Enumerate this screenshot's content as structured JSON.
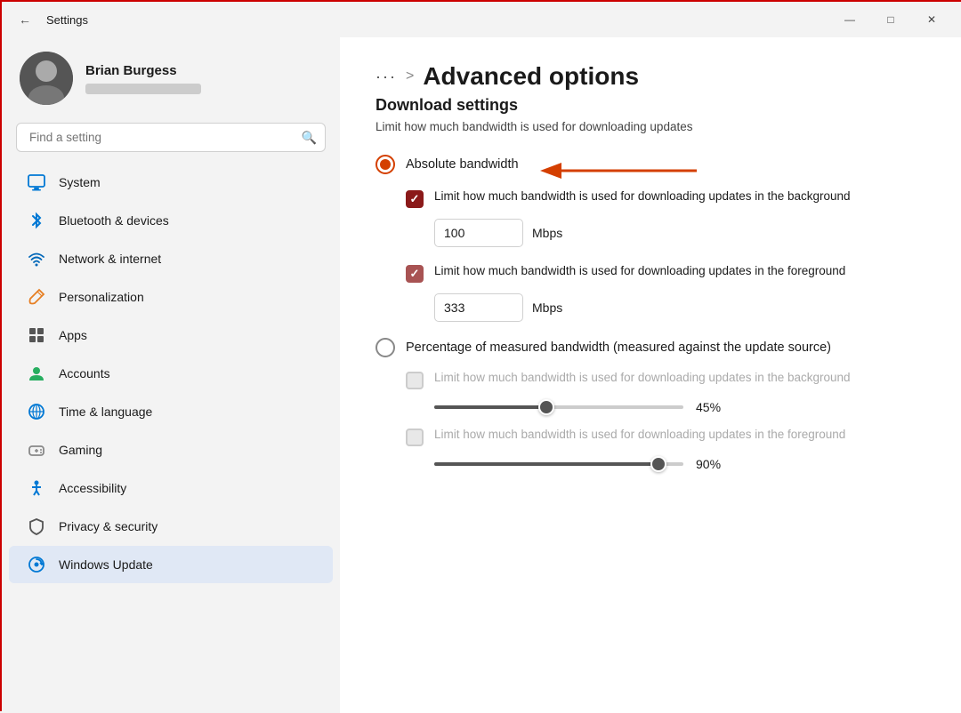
{
  "titlebar": {
    "title": "Settings",
    "back_label": "←",
    "minimize": "—",
    "maximize": "□",
    "close": "✕"
  },
  "user": {
    "name": "Brian Burgess"
  },
  "search": {
    "placeholder": "Find a setting"
  },
  "nav": {
    "items": [
      {
        "id": "system",
        "label": "System",
        "icon": "monitor"
      },
      {
        "id": "bluetooth",
        "label": "Bluetooth & devices",
        "icon": "bluetooth"
      },
      {
        "id": "network",
        "label": "Network & internet",
        "icon": "wifi"
      },
      {
        "id": "personalization",
        "label": "Personalization",
        "icon": "brush"
      },
      {
        "id": "apps",
        "label": "Apps",
        "icon": "grid"
      },
      {
        "id": "accounts",
        "label": "Accounts",
        "icon": "person"
      },
      {
        "id": "time",
        "label": "Time & language",
        "icon": "globe"
      },
      {
        "id": "gaming",
        "label": "Gaming",
        "icon": "controller"
      },
      {
        "id": "accessibility",
        "label": "Accessibility",
        "icon": "accessibility"
      },
      {
        "id": "privacy",
        "label": "Privacy & security",
        "icon": "shield"
      },
      {
        "id": "windows-update",
        "label": "Windows Update",
        "icon": "update"
      }
    ]
  },
  "main": {
    "dots": "···",
    "breadcrumb_sep": ">",
    "page_title": "Advanced options",
    "section_title": "Download settings",
    "section_desc": "Limit how much bandwidth is used for downloading updates",
    "absolute_bandwidth_label": "Absolute bandwidth",
    "checkbox1_label": "Limit how much bandwidth is used for downloading updates in the background",
    "input1_value": "100",
    "mbps1_label": "Mbps",
    "checkbox2_label": "Limit how much bandwidth is used for downloading updates in the foreground",
    "input2_value": "333",
    "mbps2_label": "Mbps",
    "percentage_label": "Percentage of measured bandwidth (measured against the update source)",
    "checkbox3_label": "Limit how much bandwidth is used for downloading updates in the background",
    "slider1_pct": "45%",
    "checkbox4_label": "Limit how much bandwidth is used for downloading updates in the foreground",
    "slider2_pct": "90%",
    "slider1_fill_pct": 45,
    "slider2_fill_pct": 90
  }
}
